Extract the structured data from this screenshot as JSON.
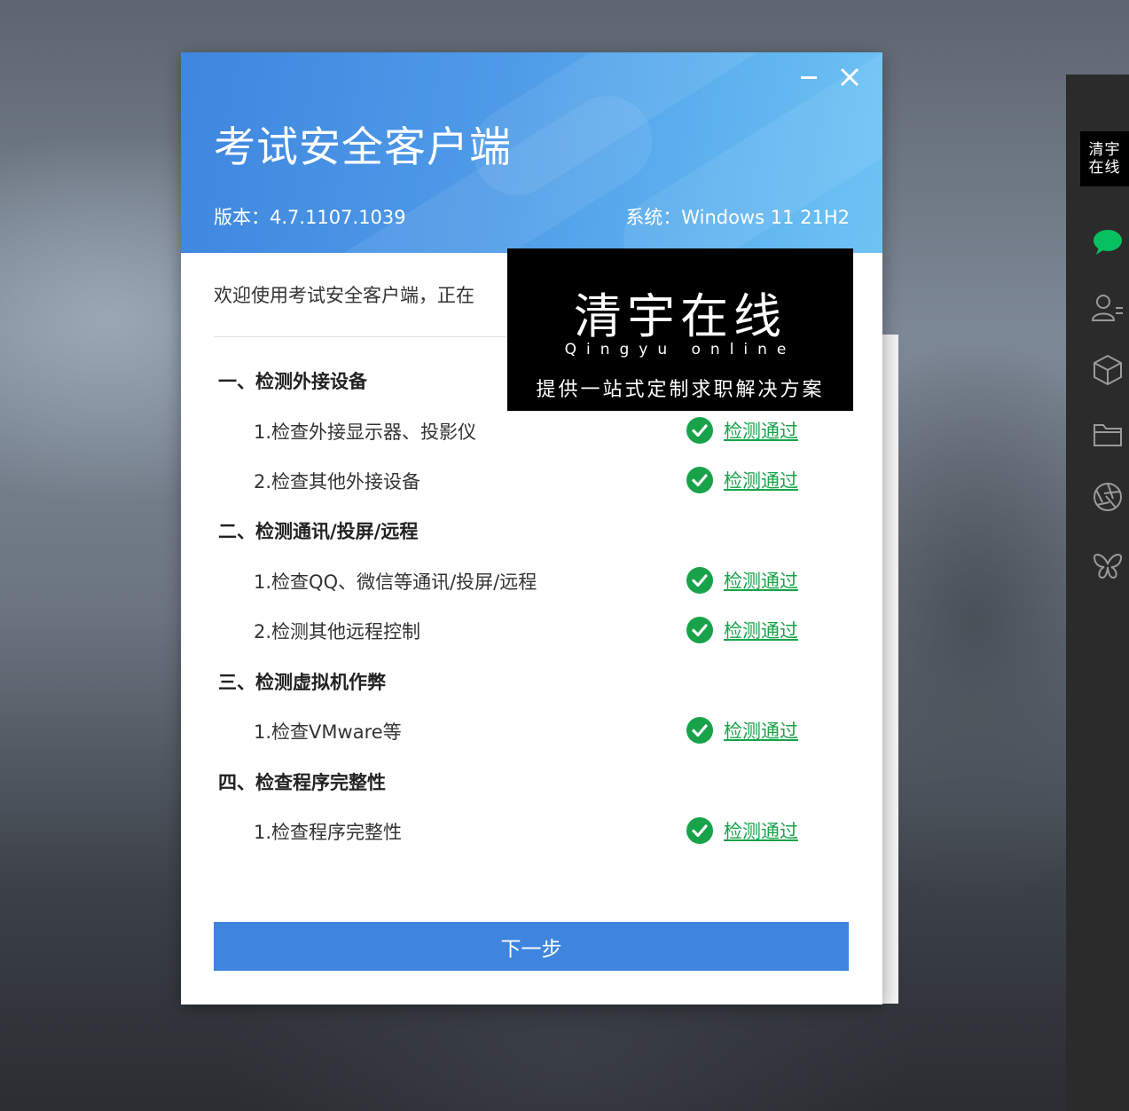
{
  "dialog": {
    "title": "考试安全客户端",
    "version": "版本：4.7.1107.1039",
    "system": "系统：Windows 11 21H2",
    "welcome": "欢迎使用考试安全客户端，正在",
    "next_button": "下一步"
  },
  "sections": [
    {
      "title": "一、检测外接设备",
      "items": [
        {
          "label": "1.检查外接显示器、投影仪",
          "status": "检测通过"
        },
        {
          "label": "2.检查其他外接设备",
          "status": "检测通过"
        }
      ]
    },
    {
      "title": "二、检测通讯/投屏/远程",
      "items": [
        {
          "label": "1.检查QQ、微信等通讯/投屏/远程",
          "status": "检测通过"
        },
        {
          "label": "2.检测其他远程控制",
          "status": "检测通过"
        }
      ]
    },
    {
      "title": "三、检测虚拟机作弊",
      "items": [
        {
          "label": "1.检查VMware等",
          "status": "检测通过"
        }
      ]
    },
    {
      "title": "四、检查程序完整性",
      "items": [
        {
          "label": "1.检查程序完整性",
          "status": "检测通过"
        }
      ]
    }
  ],
  "watermark": {
    "title": "清宇在线",
    "subtitle": "Qingyu online",
    "slogan": "提供一站式定制求职解决方案"
  },
  "sidebar": {
    "logo_line1": "清宇",
    "logo_line2": "在线",
    "icons": [
      "chat-icon",
      "contacts-icon",
      "cube-icon",
      "folder-icon",
      "aperture-icon",
      "butterfly-icon"
    ]
  },
  "colors": {
    "header_blue": "#3f86df",
    "button_blue": "#3f85df",
    "pass_green": "#18a34a",
    "chat_green": "#07c160"
  }
}
